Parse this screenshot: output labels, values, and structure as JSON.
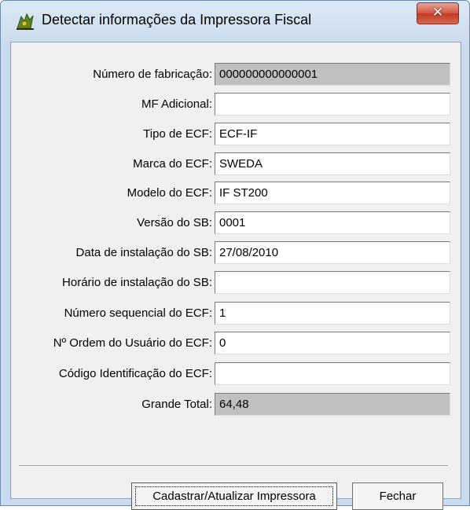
{
  "window": {
    "title": "Detectar informações da Impressora Fiscal",
    "close_label": "✕"
  },
  "fields": [
    {
      "label": "Número de fabricação:",
      "value": "000000000000001",
      "readonly": true
    },
    {
      "label": "MF Adicional:",
      "value": "",
      "readonly": false
    },
    {
      "label": "Tipo de ECF:",
      "value": "ECF-IF",
      "readonly": false
    },
    {
      "label": "Marca do ECF:",
      "value": "SWEDA",
      "readonly": false
    },
    {
      "label": "Modelo do ECF:",
      "value": "IF ST200",
      "readonly": false
    },
    {
      "label": "Versão do SB:",
      "value": "0001",
      "readonly": false
    },
    {
      "label": "Data de instalação do SB:",
      "value": "27/08/2010",
      "readonly": false
    },
    {
      "label": "Horário de instalação do SB:",
      "value": "",
      "readonly": false
    },
    {
      "label": "Número sequencial do ECF:",
      "value": "1",
      "readonly": false
    },
    {
      "label": "Nº Ordem do Usuário do ECF:",
      "value": "0",
      "readonly": false
    },
    {
      "label": "Código Identificação do ECF:",
      "value": "",
      "readonly": false
    },
    {
      "label": "Grande Total:",
      "value": "64,48",
      "readonly": true
    }
  ],
  "buttons": {
    "primary_label": "Cadastrar/Atualizar Impressora",
    "secondary_label": "Fechar"
  },
  "colors": {
    "readonly_field": "#c0c0c0",
    "close_button": "#c13a22"
  }
}
